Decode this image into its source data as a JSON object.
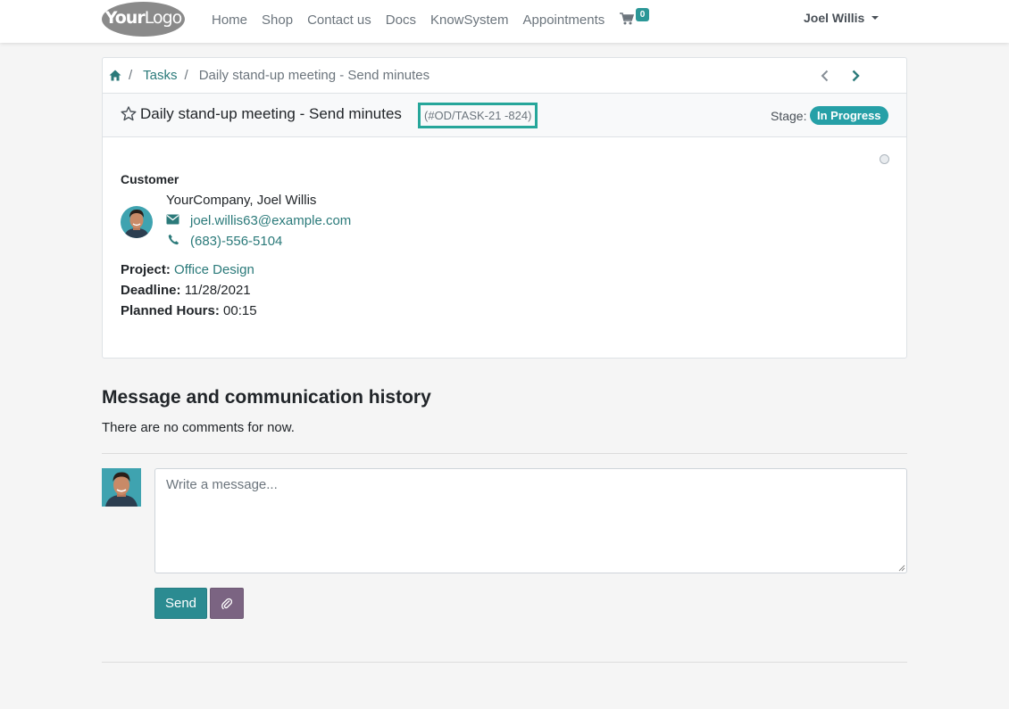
{
  "navbar": {
    "logo_bold": "Your",
    "logo_light": "Logo",
    "links": [
      "Home",
      "Shop",
      "Contact us",
      "Docs",
      "KnowSystem",
      "Appointments"
    ],
    "cart_count": "0",
    "user_name": "Joel Willis"
  },
  "breadcrumb": {
    "separator": "/",
    "tasks": "Tasks",
    "current": "Daily stand-up meeting - Send minutes"
  },
  "task": {
    "title": "Daily stand-up meeting - Send minutes",
    "reference": "(#OD/TASK-21 -824)",
    "stage_label": "Stage:",
    "stage_value": "In Progress"
  },
  "customer": {
    "label": "Customer",
    "name": "YourCompany, Joel Willis",
    "email": "joel.willis63@example.com",
    "phone": "(683)-556-5104"
  },
  "fields": {
    "project_label": "Project:",
    "project_value": "Office Design",
    "deadline_label": "Deadline:",
    "deadline_value": "11/28/2021",
    "hours_label": "Planned Hours:",
    "hours_value": "00:15"
  },
  "history": {
    "title": "Message and communication history",
    "empty_text": "There are no comments for now."
  },
  "composer": {
    "placeholder": "Write a message...",
    "send_label": "Send"
  },
  "colors": {
    "accent": "#2b8b91",
    "link": "#2b7a7a",
    "stage_badge": "#26a0a7",
    "highlight_border": "#26a69a",
    "attach_button": "#7b6482"
  },
  "icons": [
    "home-icon",
    "chevron-left-icon",
    "chevron-right-icon",
    "star-outline-icon",
    "envelope-icon",
    "phone-icon",
    "cart-icon",
    "paperclip-icon"
  ]
}
